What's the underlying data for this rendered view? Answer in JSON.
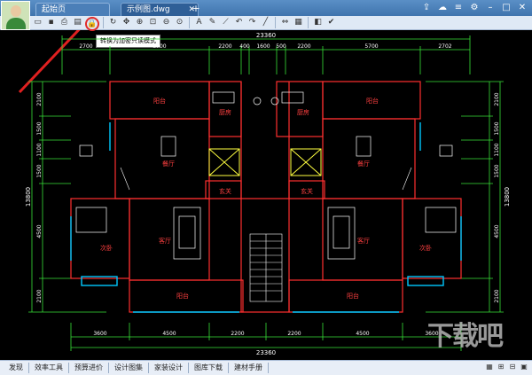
{
  "tabs": [
    {
      "label": "起始页"
    },
    {
      "label": "示例图.dwg"
    }
  ],
  "tooltip": "转换为加密只读模式",
  "dimensions": {
    "top_total": "23360",
    "top": [
      "2700",
      "5700",
      "2200",
      "400",
      "1600",
      "500",
      "2200",
      "5700",
      "2702"
    ],
    "bottom": [
      "3600",
      "4500",
      "2200",
      "2200",
      "4500",
      "3600"
    ],
    "bottom_total": "23360",
    "left": [
      "2100",
      "1500",
      "1100",
      "1500",
      "4500",
      "2100"
    ],
    "left_total": "13800",
    "right": [
      "2100",
      "1500",
      "1100",
      "1500",
      "4500",
      "2100"
    ],
    "right_total": "13800"
  },
  "rooms": {
    "balcony_nw": "阳台",
    "kitchen_w": "厨房",
    "kitchen_e": "厨房",
    "balcony_ne": "阳台",
    "dining_w": "餐厅",
    "dining_e": "餐厅",
    "foyer_w": "玄关",
    "foyer_e": "玄关",
    "bedroom_w": "次卧",
    "living_w": "客厅",
    "living_e": "客厅",
    "bedroom_e": "次卧",
    "balcony_sw": "阳台",
    "balcony_se": "阳台"
  },
  "status": [
    {
      "label": "发现"
    },
    {
      "label": "效率工具"
    },
    {
      "label": "预算进价"
    },
    {
      "label": "设计图集"
    },
    {
      "label": "家装设计"
    },
    {
      "label": "图库下载"
    },
    {
      "label": "建材手册"
    }
  ],
  "watermark": "下载吧",
  "colors": {
    "wall": "#ff3030",
    "dim": "#38e038",
    "fixture": "#ffffff",
    "window": "#00c8ff",
    "text": "#ff4040"
  }
}
